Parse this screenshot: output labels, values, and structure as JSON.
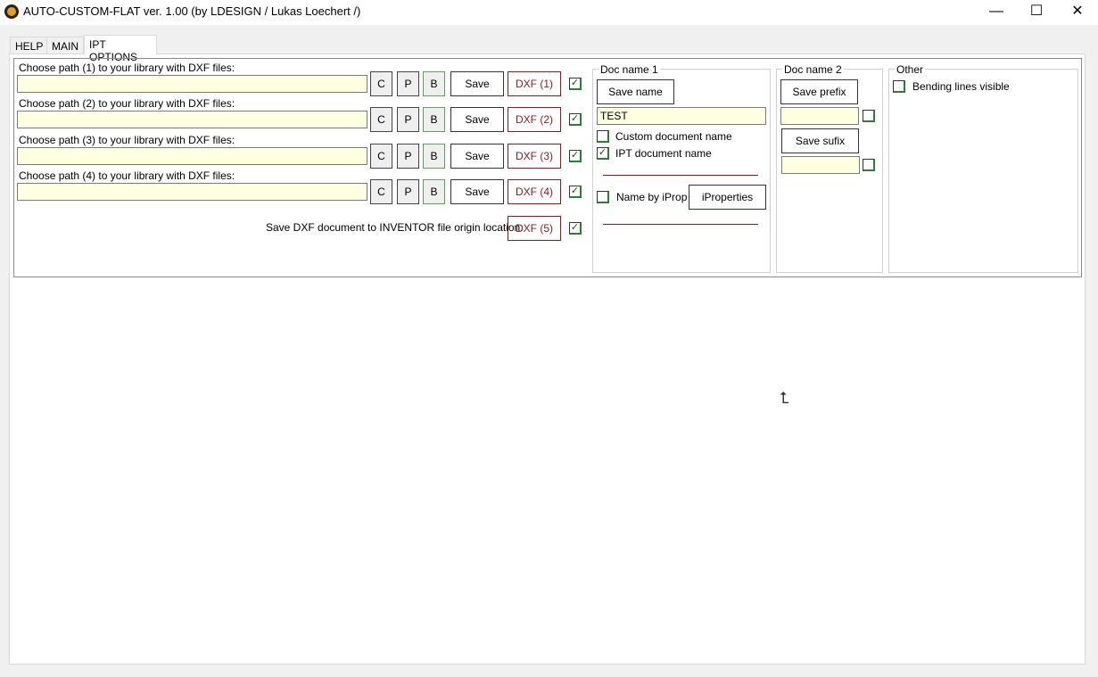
{
  "window": {
    "title": "AUTO-CUSTOM-FLAT ver. 1.00 (by LDESIGN / Lukas Loechert /)",
    "minimize": "—",
    "maximize": "☐",
    "close": "✕"
  },
  "tabs": [
    {
      "label": "HELP"
    },
    {
      "label": "MAIN"
    },
    {
      "label": "IPT OPTIONS",
      "active": true
    }
  ],
  "paths": [
    {
      "label": "Choose path (1) to your library with DXF files:",
      "value": "",
      "c": "C",
      "p": "P",
      "b": "B",
      "save": "Save",
      "dxf": "DXF (1)",
      "checked": true
    },
    {
      "label": "Choose path (2) to your library with DXF files:",
      "value": "",
      "c": "C",
      "p": "P",
      "b": "B",
      "save": "Save",
      "dxf": "DXF (2)",
      "checked": true
    },
    {
      "label": "Choose path (3) to your library with DXF files:",
      "value": "",
      "c": "C",
      "p": "P",
      "b": "B",
      "save": "Save",
      "dxf": "DXF (3)",
      "checked": true
    },
    {
      "label": "Choose path (4) to your library with DXF files:",
      "value": "",
      "c": "C",
      "p": "P",
      "b": "B",
      "save": "Save",
      "dxf": "DXF (4)",
      "checked": true
    }
  ],
  "origin": {
    "label": "Save DXF document to INVENTOR file origin location:",
    "dxf": "DXF (5)",
    "checked": true
  },
  "docname1": {
    "title": "Doc name 1",
    "save_name": "Save name",
    "name_value": "TEST",
    "custom_label": "Custom document name",
    "custom_checked": false,
    "ipt_label": "IPT document name",
    "ipt_checked": true,
    "iprop_label": "Name by iProp",
    "iprop_checked": false,
    "iproperties": "iProperties"
  },
  "docname2": {
    "title": "Doc name 2",
    "save_prefix": "Save prefix",
    "prefix_value": "",
    "prefix_checked": false,
    "save_sufix": "Save sufix",
    "sufix_value": "",
    "sufix_checked": false
  },
  "other": {
    "title": "Other",
    "bending_label": "Bending lines visible",
    "bending_checked": false
  },
  "colors": {
    "input_bg": "#ffffe1",
    "dxf_red": "#8b1a1a",
    "check_green": "#2e7d32"
  }
}
